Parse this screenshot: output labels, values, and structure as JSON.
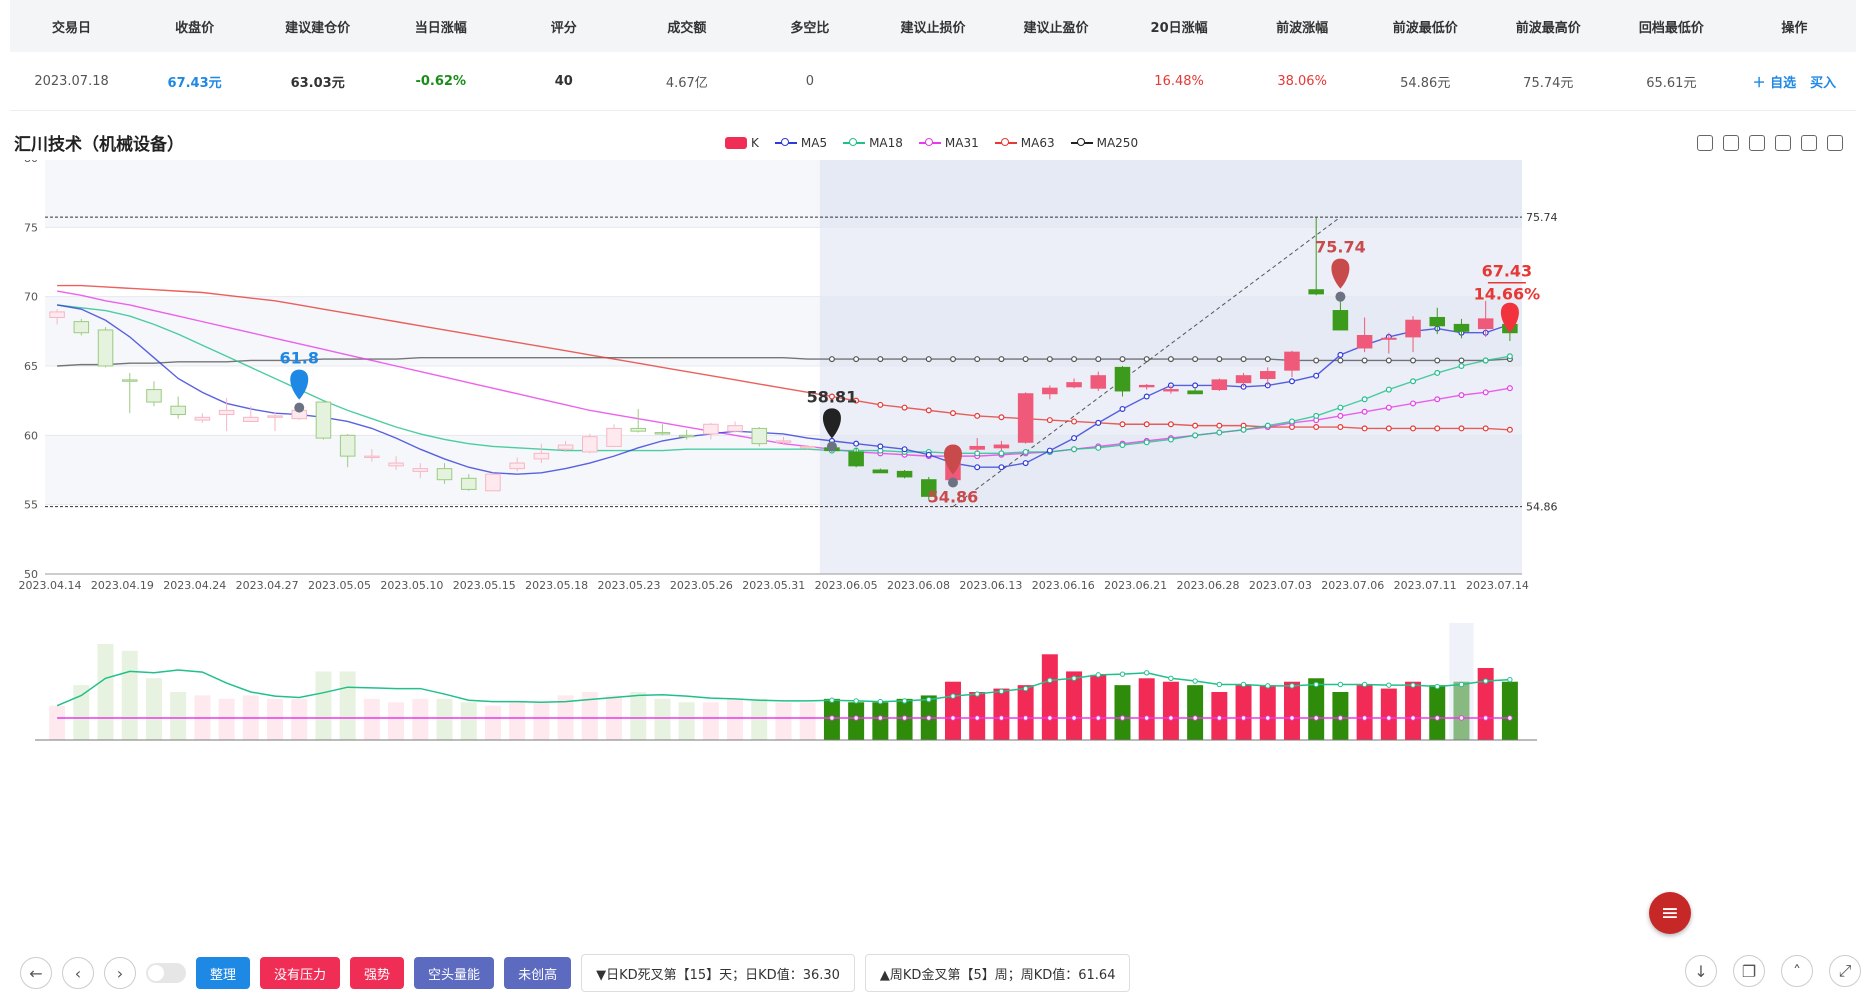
{
  "header": {
    "columns": [
      "交易日",
      "收盘价",
      "建议建仓价",
      "当日涨幅",
      "评分",
      "成交额",
      "多空比",
      "建议止损价",
      "建议止盈价",
      "20日涨幅",
      "前波涨幅",
      "前波最低价",
      "前波最高价",
      "回档最低价",
      "操作"
    ],
    "row": {
      "date": "2023.07.18",
      "close": "67.43元",
      "entry": "63.03元",
      "change": "-0.62%",
      "score": "40",
      "turnover": "4.67亿",
      "ratio": "0",
      "stop_loss": "",
      "take_profit": "",
      "chg20": "16.48%",
      "wave_chg": "38.06%",
      "wave_low": "54.86元",
      "wave_high": "75.74元",
      "pullback_low": "65.61元"
    },
    "ops": {
      "watch": "＋ 自选",
      "buy": "买入"
    }
  },
  "title": "汇川技术（机械设备）",
  "legend": [
    {
      "name": "K",
      "color": "#ef2d55"
    },
    {
      "name": "MA5",
      "color": "#2f3bd9"
    },
    {
      "name": "MA18",
      "color": "#21c08b"
    },
    {
      "name": "MA31",
      "color": "#e83be8"
    },
    {
      "name": "MA63",
      "color": "#e53935"
    },
    {
      "name": "MA250",
      "color": "#222222"
    }
  ],
  "chart_data": {
    "type": "candlestick",
    "ylim": [
      50,
      80
    ],
    "yticks": [
      "80",
      "75",
      "70",
      "65",
      "60",
      "55",
      "50"
    ],
    "xticks": [
      "2023.04.14",
      "2023.04.19",
      "2023.04.24",
      "2023.04.27",
      "2023.05.05",
      "2023.05.10",
      "2023.05.15",
      "2023.05.18",
      "2023.05.23",
      "2023.05.26",
      "2023.05.31",
      "2023.06.05",
      "2023.06.08",
      "2023.06.13",
      "2023.06.16",
      "2023.06.21",
      "2023.06.28",
      "2023.07.03",
      "2023.07.06",
      "2023.07.11",
      "2023.07.14"
    ],
    "candles": [
      [
        68.5,
        68.9,
        68.0,
        69.1
      ],
      [
        68.2,
        67.4,
        67.2,
        68.4
      ],
      [
        67.6,
        65.0,
        64.9,
        67.8
      ],
      [
        64.0,
        63.9,
        61.6,
        64.5
      ],
      [
        63.3,
        62.4,
        62.1,
        63.9
      ],
      [
        62.1,
        61.5,
        61.2,
        62.8
      ],
      [
        61.1,
        61.3,
        60.9,
        61.6
      ],
      [
        61.5,
        61.8,
        60.3,
        62.7
      ],
      [
        61.0,
        61.3,
        61.0,
        62.1
      ],
      [
        61.3,
        61.4,
        60.3,
        61.7
      ],
      [
        61.2,
        61.8,
        61.1,
        62.0
      ],
      [
        62.4,
        59.8,
        59.7,
        62.4
      ],
      [
        60.0,
        58.5,
        57.7,
        60.1
      ],
      [
        58.4,
        58.5,
        58.1,
        59.0
      ],
      [
        57.8,
        58.0,
        57.5,
        58.5
      ],
      [
        57.4,
        57.6,
        56.9,
        58.0
      ],
      [
        57.6,
        56.8,
        56.5,
        58.0
      ],
      [
        56.9,
        56.1,
        56.0,
        57.2
      ],
      [
        56.0,
        57.2,
        56.0,
        57.3
      ],
      [
        57.6,
        58.0,
        57.4,
        58.4
      ],
      [
        58.3,
        58.7,
        58.0,
        59.4
      ],
      [
        59.0,
        59.3,
        58.8,
        59.6
      ],
      [
        58.8,
        59.9,
        58.7,
        60.1
      ],
      [
        59.2,
        60.5,
        59.2,
        60.8
      ],
      [
        60.5,
        60.3,
        60.2,
        61.9
      ],
      [
        60.2,
        60.1,
        60.0,
        60.8
      ],
      [
        60.0,
        59.9,
        59.7,
        60.4
      ],
      [
        60.1,
        60.8,
        59.7,
        60.9
      ],
      [
        60.3,
        60.7,
        60.2,
        61.0
      ],
      [
        60.5,
        59.4,
        59.2,
        60.6
      ],
      [
        59.5,
        59.6,
        59.3,
        59.9
      ],
      [
        59.1,
        59.2,
        59.0,
        59.3
      ],
      [
        59.1,
        58.9,
        58.8,
        59.2
      ],
      [
        58.8,
        57.8,
        57.7,
        59.1
      ],
      [
        57.5,
        57.3,
        57.3,
        57.6
      ],
      [
        57.4,
        57.0,
        56.9,
        57.5
      ],
      [
        56.8,
        55.6,
        55.3,
        57.0
      ],
      [
        56.8,
        58.8,
        56.6,
        59.0
      ],
      [
        59.0,
        59.2,
        58.8,
        59.8
      ],
      [
        59.1,
        59.3,
        58.9,
        59.6
      ],
      [
        59.5,
        63.0,
        59.4,
        63.1
      ],
      [
        63.0,
        63.4,
        62.6,
        63.6
      ],
      [
        63.5,
        63.8,
        63.4,
        64.1
      ],
      [
        63.4,
        64.3,
        63.2,
        64.6
      ],
      [
        64.9,
        63.2,
        62.8,
        65.0
      ],
      [
        63.5,
        63.6,
        63.3,
        63.7
      ],
      [
        63.2,
        63.3,
        63.0,
        63.6
      ],
      [
        63.2,
        63.0,
        63.0,
        63.4
      ],
      [
        63.3,
        64.0,
        63.2,
        64.1
      ],
      [
        63.8,
        64.3,
        63.5,
        64.5
      ],
      [
        64.1,
        64.6,
        63.6,
        64.9
      ],
      [
        64.7,
        66.0,
        64.2,
        66.1
      ],
      [
        70.5,
        70.2,
        70.1,
        75.7
      ],
      [
        69.0,
        67.6,
        67.6,
        70.0
      ],
      [
        66.3,
        67.2,
        66.0,
        68.5
      ],
      [
        67.0,
        67.0,
        65.9,
        67.4
      ],
      [
        67.1,
        68.3,
        66.0,
        68.6
      ],
      [
        68.5,
        67.9,
        67.3,
        69.2
      ],
      [
        68.0,
        67.5,
        67.0,
        68.4
      ],
      [
        67.7,
        68.4,
        67.1,
        69.7
      ],
      [
        68.0,
        67.4,
        66.8,
        68.5
      ]
    ],
    "ma5": [
      69.4,
      69.1,
      68.3,
      67.1,
      65.6,
      64.1,
      63.1,
      62.3,
      61.9,
      61.6,
      61.5,
      61.3,
      61.0,
      60.5,
      59.8,
      59.0,
      58.3,
      57.7,
      57.3,
      57.2,
      57.3,
      57.6,
      58.0,
      58.5,
      59.1,
      59.6,
      59.9,
      60.1,
      60.3,
      60.2,
      60.1,
      59.8,
      59.6,
      59.4,
      59.2,
      59.0,
      58.6,
      58.0,
      57.7,
      57.7,
      58.0,
      58.9,
      59.8,
      60.9,
      61.9,
      62.8,
      63.6,
      63.6,
      63.6,
      63.5,
      63.6,
      63.9,
      64.3,
      65.8,
      66.5,
      67.1,
      67.5,
      67.7,
      67.4,
      67.4,
      68.0
    ],
    "ma18": [
      69.4,
      69.2,
      69.0,
      68.6,
      68.0,
      67.3,
      66.5,
      65.7,
      64.9,
      64.1,
      63.3,
      62.5,
      61.8,
      61.2,
      60.6,
      60.1,
      59.7,
      59.4,
      59.2,
      59.1,
      59.0,
      58.9,
      58.9,
      58.9,
      58.9,
      58.9,
      59.0,
      59.0,
      59.0,
      59.0,
      59.0,
      59.0,
      58.9,
      58.9,
      58.9,
      58.8,
      58.8,
      58.7,
      58.7,
      58.7,
      58.8,
      58.8,
      59.0,
      59.1,
      59.3,
      59.5,
      59.7,
      60.0,
      60.2,
      60.4,
      60.7,
      61.0,
      61.4,
      62.0,
      62.6,
      63.3,
      63.9,
      64.5,
      65.0,
      65.4,
      65.7
    ],
    "ma31": [
      70.4,
      70.1,
      69.7,
      69.4,
      69.0,
      68.6,
      68.2,
      67.8,
      67.4,
      67.0,
      66.6,
      66.2,
      65.8,
      65.4,
      65.0,
      64.6,
      64.2,
      63.8,
      63.4,
      63.0,
      62.6,
      62.2,
      61.8,
      61.5,
      61.2,
      60.9,
      60.6,
      60.3,
      60.0,
      59.7,
      59.4,
      59.2,
      59.0,
      58.8,
      58.7,
      58.6,
      58.5,
      58.5,
      58.5,
      58.6,
      58.7,
      58.8,
      59.0,
      59.2,
      59.4,
      59.6,
      59.8,
      60.0,
      60.2,
      60.4,
      60.6,
      60.9,
      61.1,
      61.4,
      61.7,
      62.0,
      62.3,
      62.6,
      62.9,
      63.1,
      63.4
    ],
    "ma63": [
      70.8,
      70.8,
      70.7,
      70.6,
      70.5,
      70.4,
      70.3,
      70.1,
      69.9,
      69.7,
      69.4,
      69.1,
      68.8,
      68.5,
      68.2,
      67.9,
      67.6,
      67.3,
      67.0,
      66.7,
      66.4,
      66.1,
      65.8,
      65.5,
      65.2,
      64.9,
      64.6,
      64.3,
      64.0,
      63.7,
      63.4,
      63.1,
      62.8,
      62.5,
      62.2,
      62.0,
      61.8,
      61.6,
      61.4,
      61.3,
      61.2,
      61.1,
      61.0,
      60.9,
      60.8,
      60.8,
      60.8,
      60.7,
      60.7,
      60.7,
      60.6,
      60.6,
      60.6,
      60.6,
      60.5,
      60.5,
      60.5,
      60.5,
      60.5,
      60.5,
      60.4
    ],
    "ma250": [
      65.0,
      65.1,
      65.1,
      65.2,
      65.2,
      65.3,
      65.3,
      65.3,
      65.4,
      65.4,
      65.4,
      65.5,
      65.5,
      65.5,
      65.5,
      65.6,
      65.6,
      65.6,
      65.6,
      65.6,
      65.6,
      65.6,
      65.6,
      65.6,
      65.6,
      65.6,
      65.6,
      65.6,
      65.6,
      65.6,
      65.6,
      65.5,
      65.5,
      65.5,
      65.5,
      65.5,
      65.5,
      65.5,
      65.5,
      65.5,
      65.5,
      65.5,
      65.5,
      65.5,
      65.5,
      65.5,
      65.5,
      65.5,
      65.5,
      65.5,
      65.5,
      65.4,
      65.4,
      65.4,
      65.4,
      65.4,
      65.4,
      65.4,
      65.4,
      65.4,
      65.5
    ],
    "volumes": [
      10,
      16,
      28,
      26,
      18,
      14,
      13,
      12,
      13,
      12,
      12,
      20,
      20,
      12,
      11,
      12,
      12,
      11,
      10,
      11,
      11,
      13,
      14,
      13,
      14,
      12,
      11,
      11,
      12,
      12,
      11,
      11,
      12,
      11,
      11,
      12,
      13,
      17,
      14,
      15,
      16,
      25,
      20,
      19,
      16,
      18,
      17,
      16,
      14,
      16,
      16,
      17,
      18,
      14,
      16,
      15,
      17,
      16,
      17,
      21,
      17
    ],
    "markers": [
      {
        "label": "61.8",
        "idx": 10,
        "color": "#1e88e5"
      },
      {
        "label": "58.81",
        "idx": 32,
        "color": "#222"
      },
      {
        "label": "54.86",
        "idx": 37,
        "color": "#c94a4a",
        "below": true
      },
      {
        "label": "75.74",
        "idx": 53,
        "color": "#c94a4a"
      }
    ],
    "hlines": [
      "75.74",
      "54.86"
    ],
    "last_price": "67.43",
    "last_change": "14.66%"
  },
  "buttons": {
    "sort": "整理",
    "no_pressure": "没有压力",
    "strong": "强势",
    "bear_energy": "空头量能",
    "not_new_high": "未创高"
  },
  "info": {
    "daily_kd": "▼日KD死叉第【15】天；日KD值：36.30",
    "weekly_kd": "▲周KD金叉第【5】周；周KD值：61.64"
  }
}
